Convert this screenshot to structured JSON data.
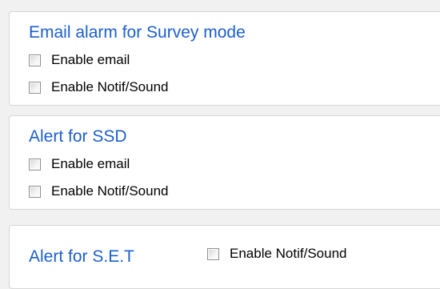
{
  "groups": {
    "email_alarm": {
      "title": "Email alarm for Survey mode",
      "options": {
        "enable_email": {
          "label": "Enable email",
          "checked": false
        },
        "enable_notif_sound": {
          "label": "Enable Notif/Sound",
          "checked": false
        }
      }
    },
    "ssd_alert": {
      "title": "Alert for SSD",
      "options": {
        "enable_email": {
          "label": "Enable email",
          "checked": false
        },
        "enable_notif_sound": {
          "label": "Enable Notif/Sound",
          "checked": false
        }
      }
    },
    "set_alert": {
      "title": "Alert for S.E.T",
      "options": {
        "enable_notif_sound": {
          "label": "Enable Notif/Sound",
          "checked": false
        }
      }
    }
  },
  "colors": {
    "group_title": "#1c5fcc",
    "background": "#f1f1f1",
    "panel": "#ffffff"
  }
}
